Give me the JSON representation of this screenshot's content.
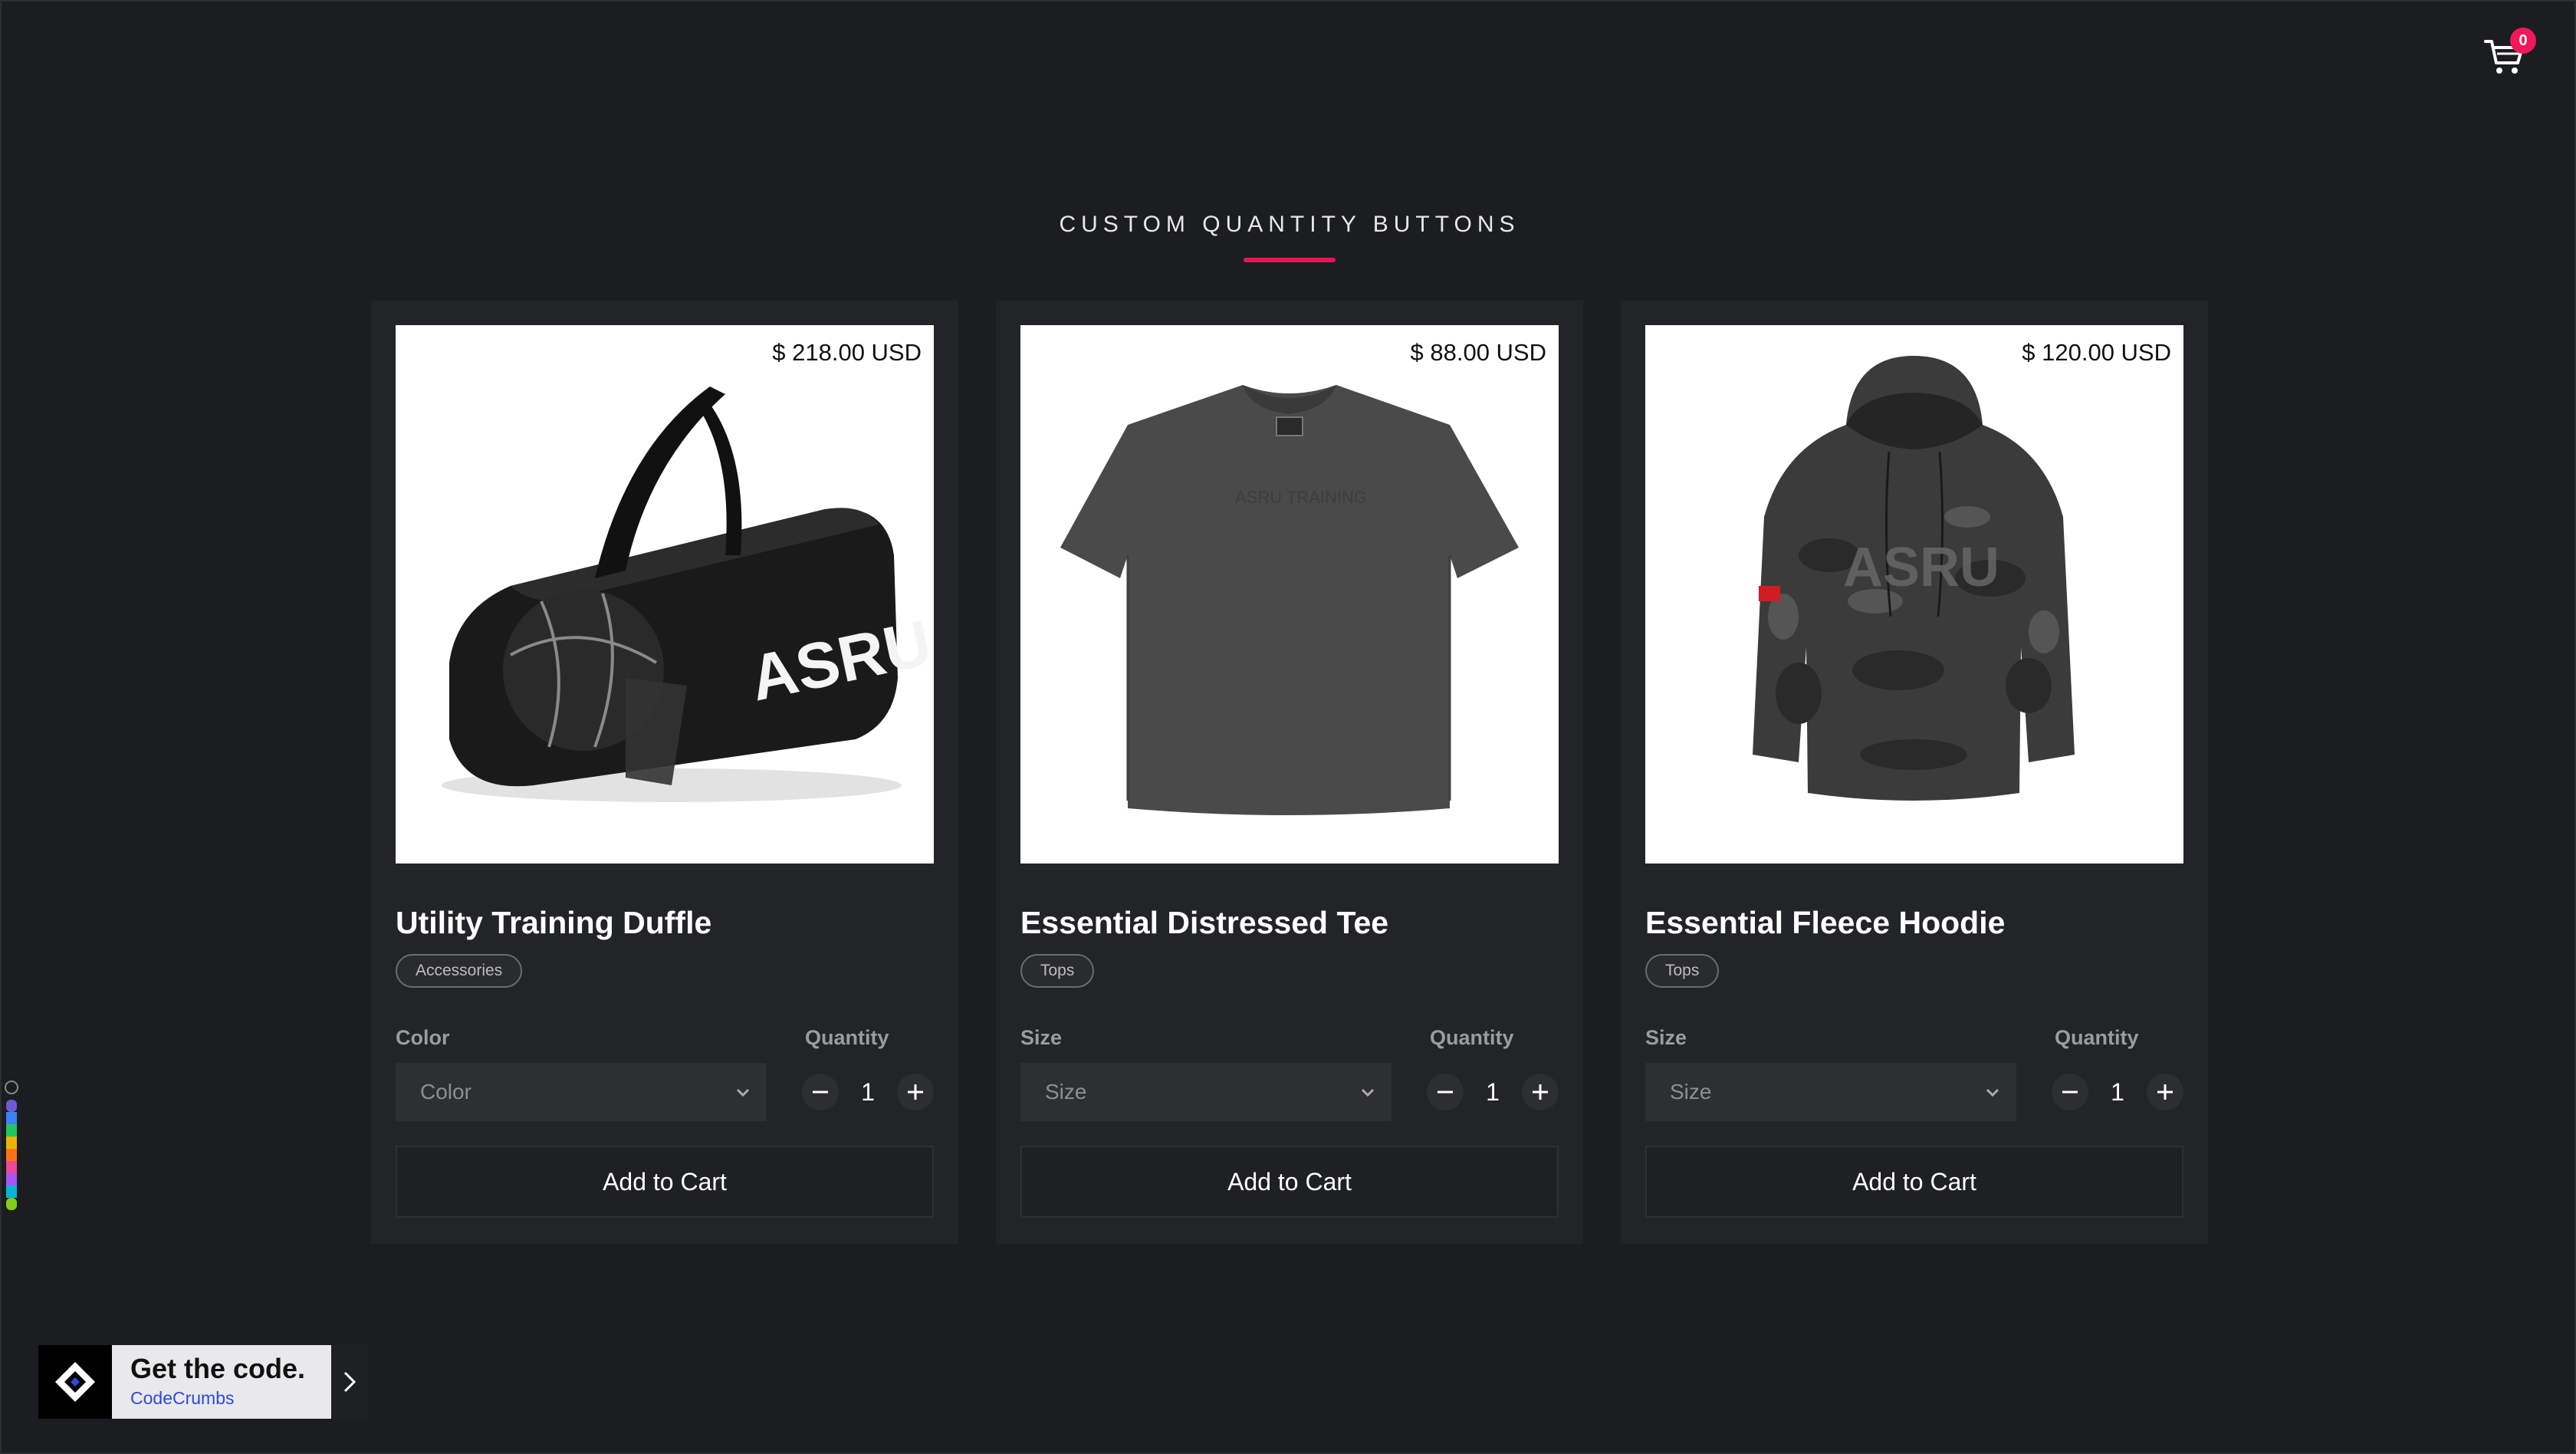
{
  "cart": {
    "count": "0",
    "icon": "cart-icon"
  },
  "section": {
    "title": "CUSTOM QUANTITY BUTTONS",
    "accent": "#e8154f"
  },
  "products": [
    {
      "price": "$ 218.00 USD",
      "name": "Utility Training Duffle",
      "tag": "Accessories",
      "option_label": "Color",
      "option_placeholder": "Color",
      "quantity_label": "Quantity",
      "quantity": "1",
      "add_label": "Add to Cart",
      "image": "black-duffle-bag-image"
    },
    {
      "price": "$ 88.00 USD",
      "name": "Essential Distressed Tee",
      "tag": "Tops",
      "option_label": "Size",
      "option_placeholder": "Size",
      "quantity_label": "Quantity",
      "quantity": "1",
      "add_label": "Add to Cart",
      "image": "grey-tshirt-image"
    },
    {
      "price": "$ 120.00 USD",
      "name": "Essential Fleece Hoodie",
      "tag": "Tops",
      "option_label": "Size",
      "option_placeholder": "Size",
      "quantity_label": "Quantity",
      "quantity": "1",
      "add_label": "Add to Cart",
      "image": "camo-hoodie-image"
    }
  ],
  "promo": {
    "title": "Get the code.",
    "subtitle": "CodeCrumbs",
    "link_color": "#2d49e0"
  }
}
